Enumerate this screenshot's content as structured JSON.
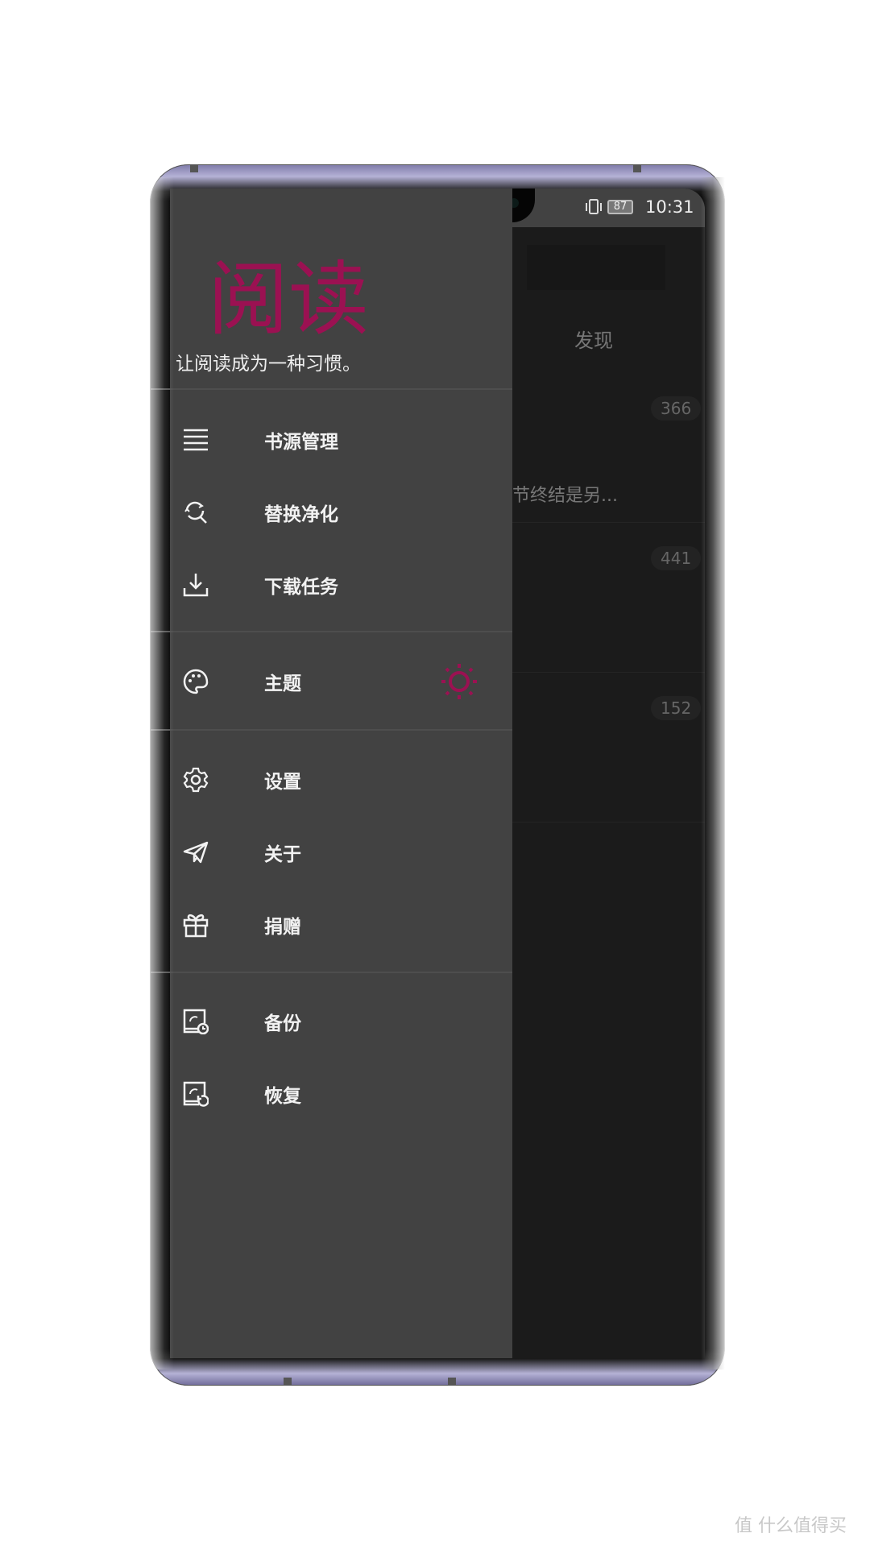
{
  "status_bar": {
    "left_icons": [
      "hd-icon",
      "signal-4g-icon",
      "signal-4g-icon",
      "wifi-icon"
    ],
    "battery": "87",
    "time": "10:31"
  },
  "drawer": {
    "logo": "阅读",
    "slogan": "让阅读成为一种习惯。",
    "accent_color": "#9b1152",
    "items": [
      {
        "label": "书源管理",
        "icon": "list-icon"
      },
      {
        "label": "替换净化",
        "icon": "replace-search-icon"
      },
      {
        "label": "下载任务",
        "icon": "download-icon"
      },
      {
        "label": "主题",
        "icon": "palette-icon",
        "trailing_icon": "sun-icon"
      },
      {
        "label": "设置",
        "icon": "gear-icon"
      },
      {
        "label": "关于",
        "icon": "paper-plane-icon"
      },
      {
        "label": "捐赠",
        "icon": "gift-icon"
      },
      {
        "label": "备份",
        "icon": "backup-icon"
      },
      {
        "label": "恢复",
        "icon": "restore-icon"
      }
    ]
  },
  "background": {
    "tab": "发现",
    "snippet": "节终结是另...",
    "badges": [
      "366",
      "441",
      "152"
    ]
  },
  "watermark": "值 什么值得买"
}
